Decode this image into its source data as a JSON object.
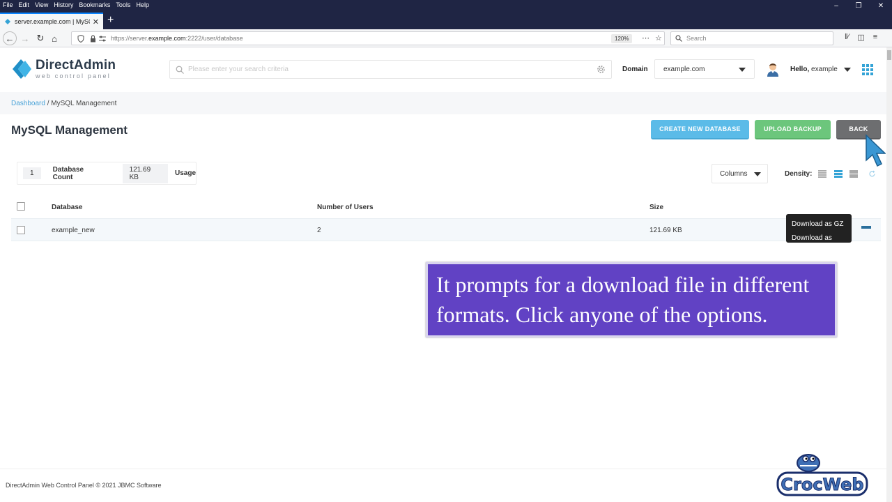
{
  "browser": {
    "menu": [
      "File",
      "Edit",
      "View",
      "History",
      "Bookmarks",
      "Tools",
      "Help"
    ],
    "tab_title": "server.example.com | MySQL M",
    "url_prefix": "https://server.",
    "url_domain": "example.com",
    "url_suffix": ":2222/user/database",
    "zoom": "120%",
    "search_placeholder": "Search"
  },
  "app": {
    "logo_title": "DirectAdmin",
    "logo_sub": "web control panel",
    "search_placeholder": "Please enter your search criteria",
    "domain_label": "Domain",
    "domain_value": "example.com",
    "hello_prefix": "Hello,",
    "hello_user": "example",
    "accent": "#34a3d6"
  },
  "breadcrumb": {
    "link": "Dashboard",
    "separator": " / ",
    "current": "MySQL Management"
  },
  "page": {
    "title": "MySQL Management",
    "buttons": {
      "create": "CREATE NEW DATABASE",
      "upload": "UPLOAD BACKUP",
      "back": "BACK"
    }
  },
  "stats": {
    "count_value": "1",
    "count_label": "Database Count",
    "usage_value": "121.69 KB",
    "usage_label": "Usage"
  },
  "toolbar": {
    "columns": "Columns",
    "density": "Density:"
  },
  "table": {
    "headers": [
      "Database",
      "Number of Users",
      "Size"
    ],
    "rows": [
      {
        "database": "example_new",
        "users": "2",
        "size": "121.69 KB"
      }
    ]
  },
  "download_menu": {
    "options": [
      "Download as GZ",
      "Download as SQL"
    ]
  },
  "overlay": {
    "line1": "It prompts for a download file in different",
    "line2": "formats. Click anyone of the options."
  },
  "footer": {
    "text": "DirectAdmin Web Control Panel © 2021 JBMC Software"
  },
  "watermark": {
    "text": "CrocWeb"
  }
}
